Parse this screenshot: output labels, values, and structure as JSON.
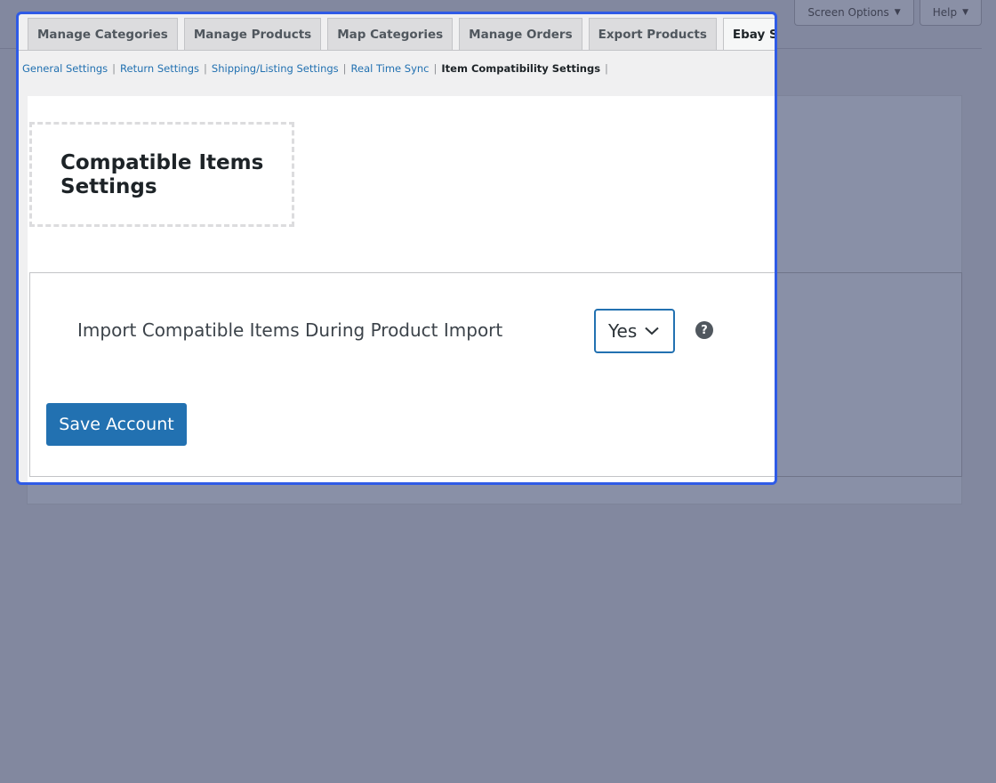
{
  "screen_meta": {
    "screen_options_label": "Screen Options",
    "help_label": "Help",
    "caret": "▼"
  },
  "tabs": [
    {
      "label": "Manage Categories",
      "active": false
    },
    {
      "label": "Manage Products",
      "active": false
    },
    {
      "label": "Map Categories",
      "active": false
    },
    {
      "label": "Manage Orders",
      "active": false
    },
    {
      "label": "Export Products",
      "active": false
    },
    {
      "label": "Ebay Settings",
      "active": true
    }
  ],
  "subnav": {
    "items": [
      "General Settings",
      "Return Settings",
      "Shipping/Listing Settings",
      "Real Time Sync",
      "Item Compatibility Settings"
    ],
    "current": "Item Compatibility Settings",
    "separator": "|"
  },
  "section": {
    "title": "Compatible Items Settings"
  },
  "setting": {
    "label": "Import Compatible Items During Product Import",
    "select_value": "Yes",
    "help_glyph": "?"
  },
  "actions": {
    "save_label": "Save Account"
  },
  "colors": {
    "accent": "#2271b1",
    "highlight_border": "#2f5be6",
    "overlay_bg": "#82889f"
  }
}
